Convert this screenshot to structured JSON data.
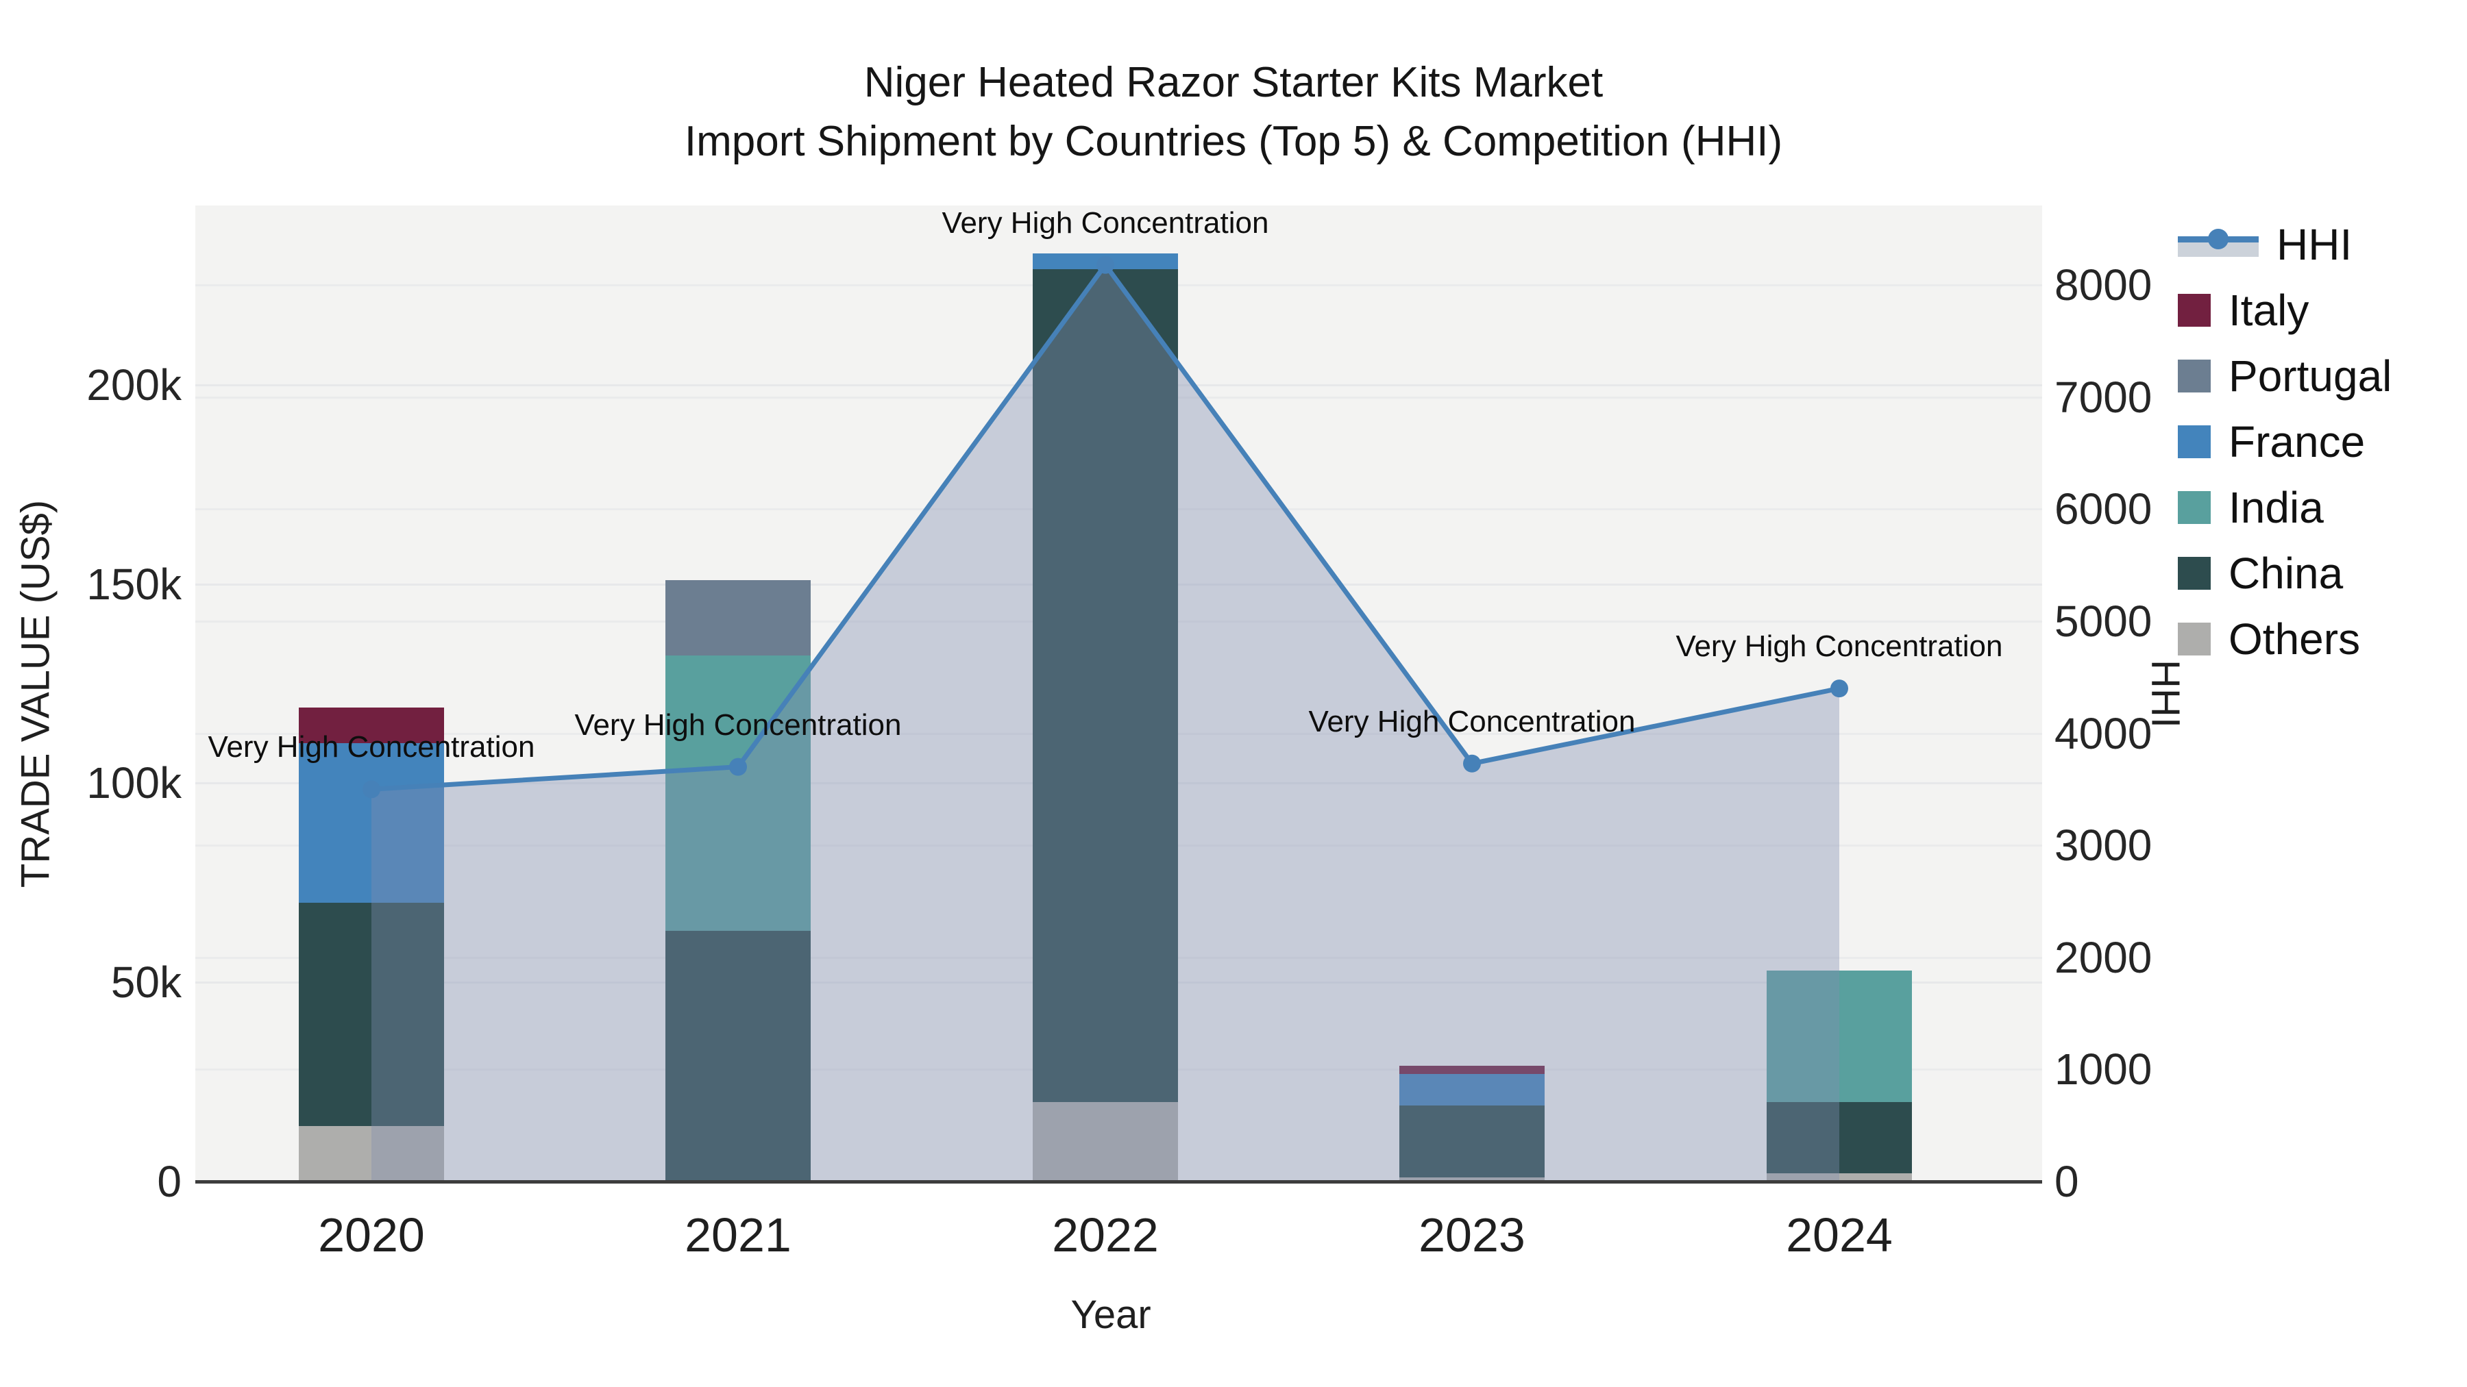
{
  "title": {
    "line1": "Niger Heated Razor Starter Kits Market",
    "line2": "Import Shipment by Countries (Top 5) & Competition (HHI)"
  },
  "axes": {
    "x": {
      "title": "Year"
    },
    "y_left": {
      "title": "TRADE VALUE (US$)",
      "max": 245000,
      "ticks": [
        {
          "value": 0,
          "label": "0"
        },
        {
          "value": 50000,
          "label": "50k"
        },
        {
          "value": 100000,
          "label": "100k"
        },
        {
          "value": 150000,
          "label": "150k"
        },
        {
          "value": 200000,
          "label": "200k"
        }
      ]
    },
    "y_right": {
      "title": "HHI",
      "max": 8710,
      "ticks": [
        {
          "value": 0,
          "label": "0"
        },
        {
          "value": 1000,
          "label": "1000"
        },
        {
          "value": 2000,
          "label": "2000"
        },
        {
          "value": 3000,
          "label": "3000"
        },
        {
          "value": 4000,
          "label": "4000"
        },
        {
          "value": 5000,
          "label": "5000"
        },
        {
          "value": 6000,
          "label": "6000"
        },
        {
          "value": 7000,
          "label": "7000"
        },
        {
          "value": 8000,
          "label": "8000"
        }
      ]
    }
  },
  "chart_data": {
    "type": "bar+line",
    "categories": [
      "2020",
      "2021",
      "2022",
      "2023",
      "2024"
    ],
    "stack_note": "stacked import trade value in US$, bottom-to-top order as listed",
    "series": [
      {
        "name": "Others",
        "color": "#aeaeac",
        "values": [
          14000,
          0,
          20000,
          1000,
          2000
        ]
      },
      {
        "name": "China",
        "color": "#2d4c4e",
        "values": [
          56000,
          63000,
          209000,
          18000,
          18000
        ]
      },
      {
        "name": "India",
        "color": "#59a09e",
        "values": [
          0,
          69000,
          0,
          0,
          33000
        ]
      },
      {
        "name": "France",
        "color": "#4384bc",
        "values": [
          40000,
          0,
          4000,
          8000,
          0
        ]
      },
      {
        "name": "Portugal",
        "color": "#6c7e91",
        "values": [
          0,
          19000,
          0,
          0,
          0
        ]
      },
      {
        "name": "Italy",
        "color": "#722040",
        "values": [
          9000,
          0,
          0,
          2000,
          0
        ]
      }
    ],
    "line_series": {
      "name": "HHI",
      "color": "#4681b8",
      "area_color": "rgba(130,143,175,0.38)",
      "values": [
        3500,
        3700,
        8180,
        3730,
        4400
      ]
    },
    "annotations": [
      {
        "year": "2020",
        "text": "Very High Concentration"
      },
      {
        "year": "2021",
        "text": "Very High Concentration"
      },
      {
        "year": "2022",
        "text": "Very High Concentration"
      },
      {
        "year": "2023",
        "text": "Very High Concentration"
      },
      {
        "year": "2024",
        "text": "Very High Concentration"
      }
    ]
  },
  "legend": {
    "items": [
      {
        "label": "HHI",
        "type": "line",
        "color": "#4681b8"
      },
      {
        "label": "Italy",
        "type": "square",
        "color": "#722040"
      },
      {
        "label": "Portugal",
        "type": "square",
        "color": "#6c7e91"
      },
      {
        "label": "France",
        "type": "square",
        "color": "#4384bc"
      },
      {
        "label": "India",
        "type": "square",
        "color": "#59a09e"
      },
      {
        "label": "China",
        "type": "square",
        "color": "#2d4c4e"
      },
      {
        "label": "Others",
        "type": "square",
        "color": "#aeaeac"
      }
    ]
  },
  "colors": {
    "plot_background": "#f3f3f2",
    "gridline": "#e7e8ea",
    "axis_line": "#3d3d3d",
    "text": "#1a1a1a"
  }
}
